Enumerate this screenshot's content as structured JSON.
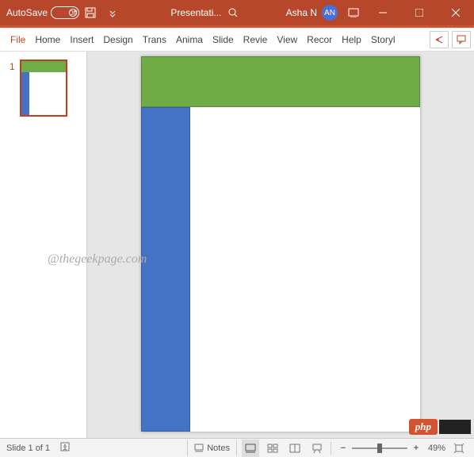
{
  "titlebar": {
    "autosave_label": "AutoSave",
    "autosave_state": "Off",
    "document_title": "Presentati...",
    "user_name": "Asha N",
    "user_initials": "AN"
  },
  "ribbon": {
    "tabs": [
      "File",
      "Home",
      "Insert",
      "Design",
      "Trans",
      "Anima",
      "Slide",
      "Revie",
      "View",
      "Recor",
      "Help",
      "Storyl"
    ]
  },
  "thumbnail": {
    "number": "1"
  },
  "watermark": "@thegeekpage.com",
  "badge": {
    "text": "php"
  },
  "statusbar": {
    "slide_info": "Slide 1 of 1",
    "notes_label": "Notes",
    "zoom_pct": "49%"
  }
}
